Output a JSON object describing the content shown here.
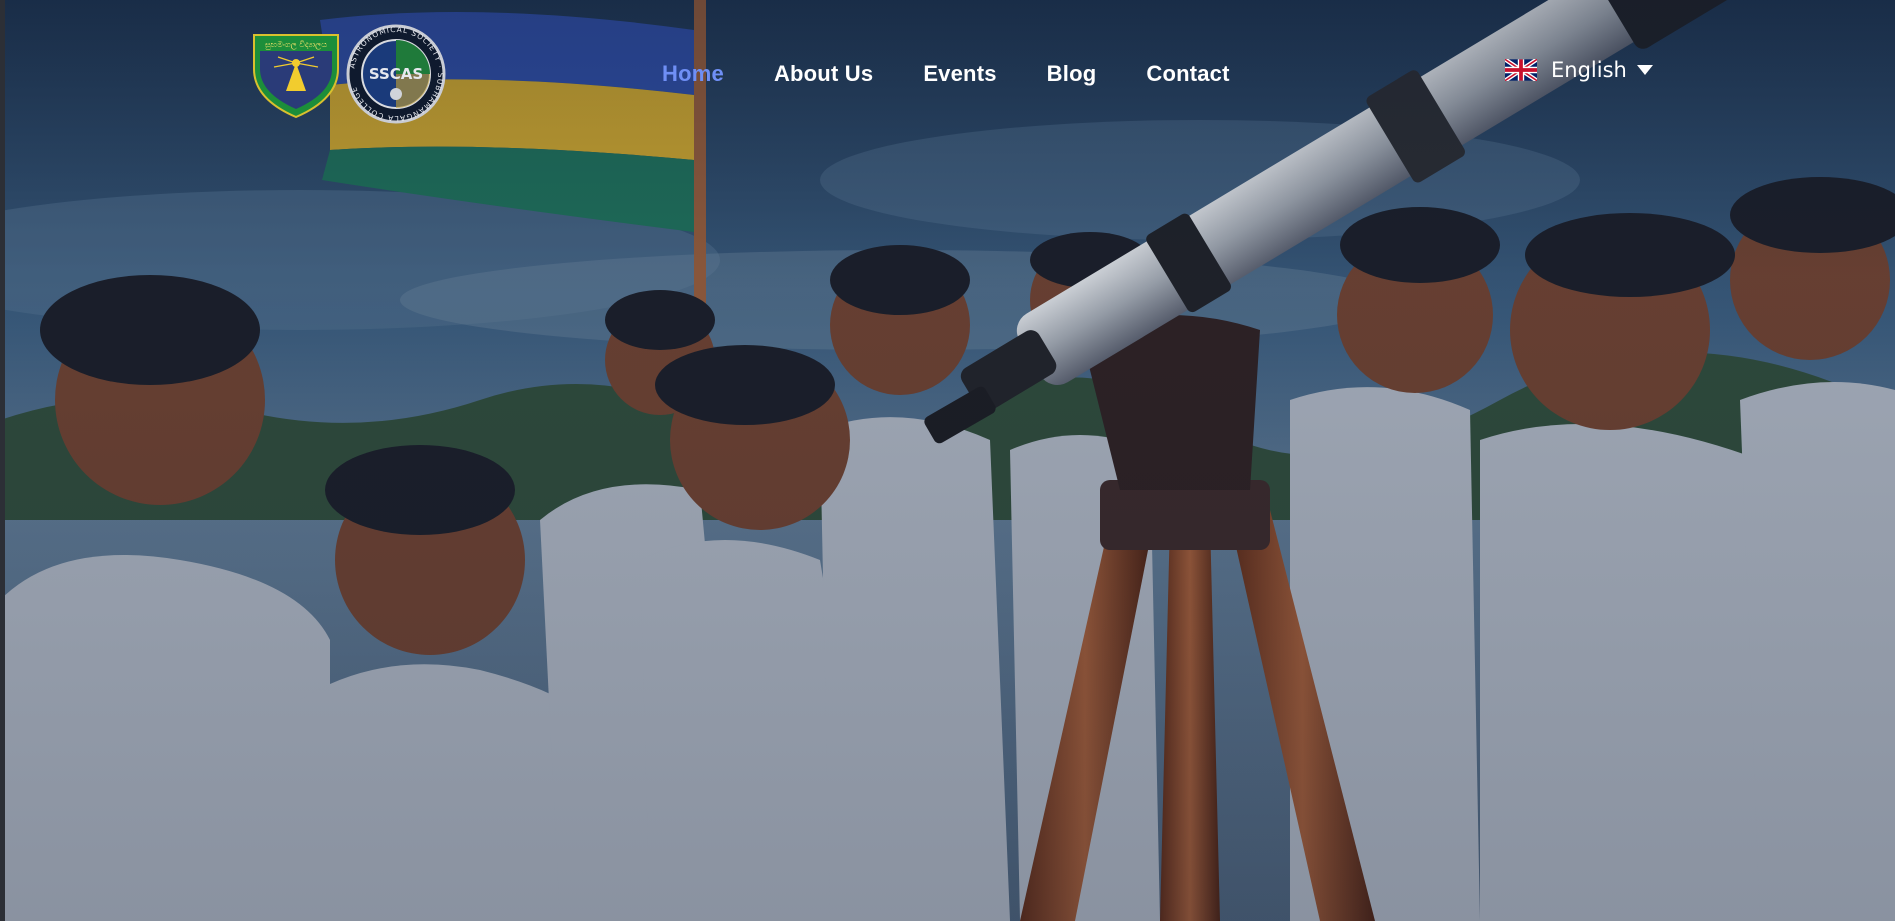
{
  "nav": {
    "items": [
      {
        "label": "Home",
        "active": true
      },
      {
        "label": "About Us",
        "active": false
      },
      {
        "label": "Events",
        "active": false
      },
      {
        "label": "Blog",
        "active": false
      },
      {
        "label": "Contact",
        "active": false
      }
    ],
    "active_color": "#6f8ff5"
  },
  "language": {
    "label": "English",
    "flag_icon": "uk-flag-icon"
  },
  "logos": {
    "school_logo_icon": "school-crest-icon",
    "society_logo_icon": "astronomical-society-seal-icon",
    "society_abbrev": "SSCAS",
    "society_ring_text": "ASTRONOMICAL SOCIETY · SUBHAMANGALA COLLEGE",
    "school_banner_text": "සුභමංගල විද්‍යාලය"
  },
  "hero": {
    "image_icon": "students-with-telescope-image"
  },
  "colors": {
    "sky": "#33506f",
    "flag_blue": "#2e4ca1",
    "flag_yellow": "#c7a230",
    "flag_green": "#1f6e5a",
    "uniform": "#a6aebb"
  }
}
